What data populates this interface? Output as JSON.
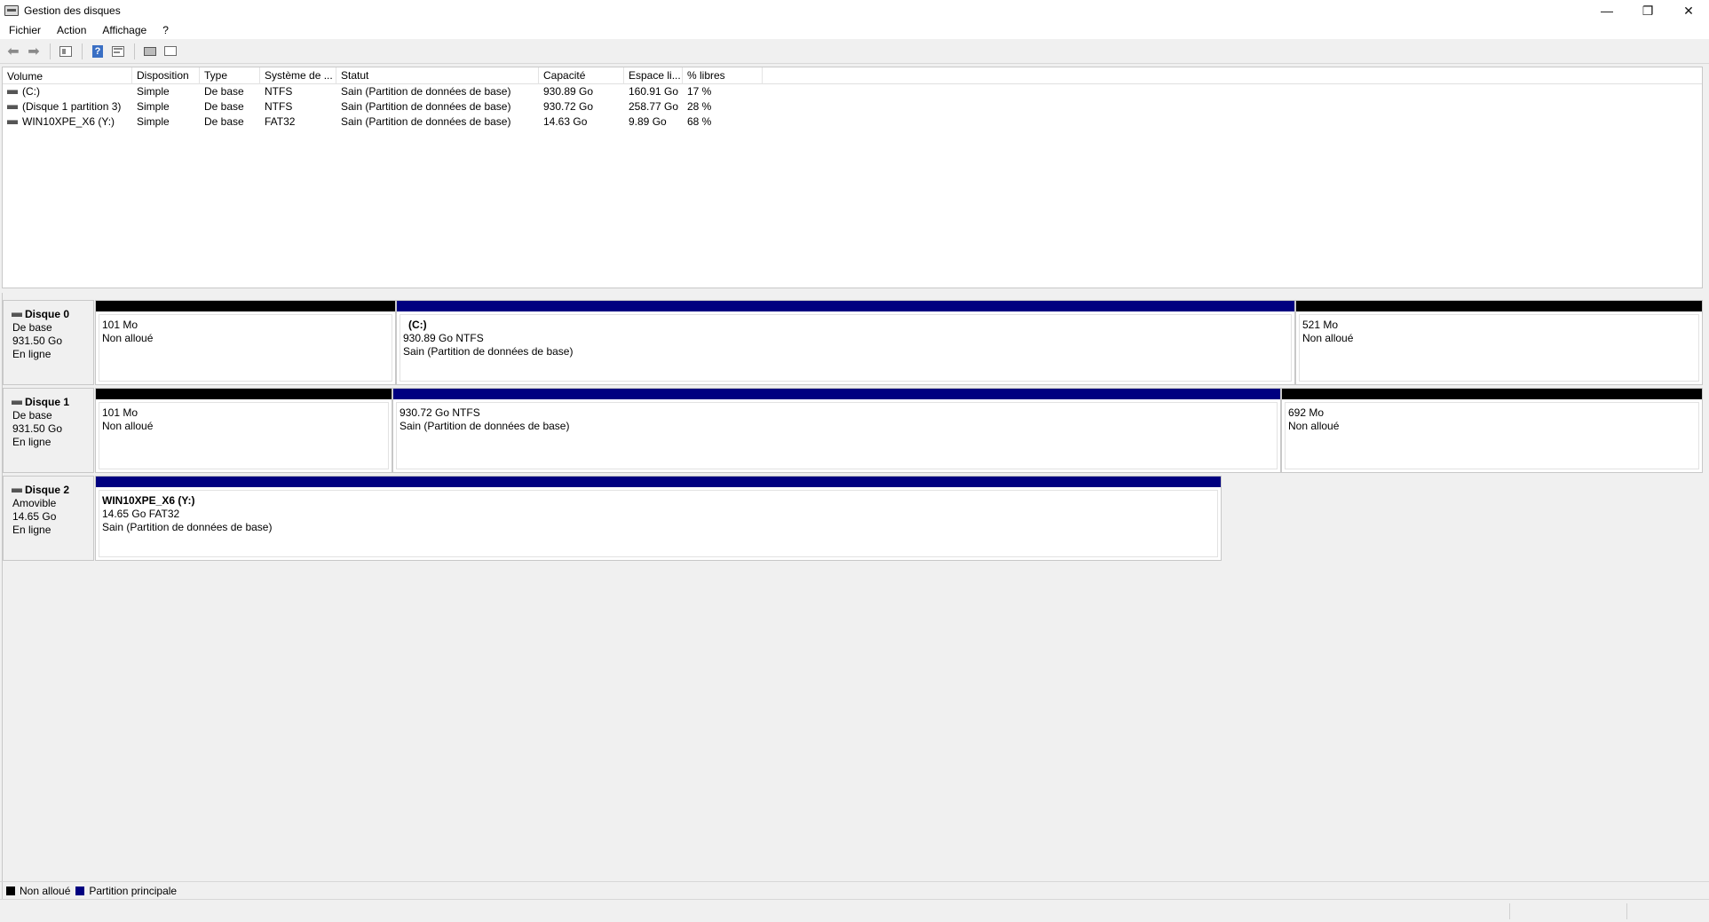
{
  "window": {
    "title": "Gestion des disques",
    "minimize_glyph": "—",
    "maximize_glyph": "❐",
    "close_glyph": "✕"
  },
  "menu": {
    "items": [
      "Fichier",
      "Action",
      "Affichage",
      "?"
    ]
  },
  "toolbar": {
    "icons": [
      "back-arrow-icon",
      "forward-arrow-icon",
      "console-tree-icon",
      "help-icon",
      "properties-icon",
      "disk-connect-icon",
      "panel-icon"
    ]
  },
  "volume_list": {
    "headers": [
      "Volume",
      "Disposition",
      "Type",
      "Système de ...",
      "Statut",
      "Capacité",
      "Espace li...",
      "% libres"
    ],
    "rows": [
      {
        "volume": "(C:)",
        "disposition": "Simple",
        "type": "De base",
        "fs": "NTFS",
        "status": "Sain (Partition de données de base)",
        "capacity": "930.89 Go",
        "free": "160.91 Go",
        "pct": "17 %"
      },
      {
        "volume": "(Disque 1 partition 3)",
        "disposition": "Simple",
        "type": "De base",
        "fs": "NTFS",
        "status": "Sain (Partition de données de base)",
        "capacity": "930.72 Go",
        "free": "258.77 Go",
        "pct": "28 %"
      },
      {
        "volume": "WIN10XPE_X6 (Y:)",
        "disposition": "Simple",
        "type": "De base",
        "fs": "FAT32",
        "status": "Sain (Partition de données de base)",
        "capacity": "14.63 Go",
        "free": "9.89 Go",
        "pct": "68 %"
      }
    ]
  },
  "disks": [
    {
      "name": "Disque 0",
      "kind": "De base",
      "size": "931.50 Go",
      "state": "En ligne",
      "partitions": [
        {
          "title": "",
          "line1": "101 Mo",
          "line2": "Non alloué",
          "color": "#000000"
        },
        {
          "title": "(C:)",
          "line1": "930.89 Go NTFS",
          "line2": "Sain (Partition de données de base)",
          "color": "#000080"
        },
        {
          "title": "",
          "line1": "521 Mo",
          "line2": "Non alloué",
          "color": "#000000"
        }
      ]
    },
    {
      "name": "Disque 1",
      "kind": "De base",
      "size": "931.50 Go",
      "state": "En ligne",
      "partitions": [
        {
          "title": "",
          "line1": "101 Mo",
          "line2": "Non alloué",
          "color": "#000000"
        },
        {
          "title": "",
          "line1": "930.72 Go NTFS",
          "line2": "Sain (Partition de données de base)",
          "color": "#000080"
        },
        {
          "title": "",
          "line1": "692 Mo",
          "line2": "Non alloué",
          "color": "#000000"
        }
      ]
    },
    {
      "name": "Disque 2",
      "kind": "Amovible",
      "size": "14.65 Go",
      "state": "En ligne",
      "partitions": [
        {
          "title": "WIN10XPE_X6  (Y:)",
          "line1": "14.65 Go FAT32",
          "line2": "Sain (Partition de données de base)",
          "color": "#000080"
        }
      ]
    }
  ],
  "legend": [
    {
      "label": "Non alloué",
      "color": "#000000"
    },
    {
      "label": "Partition principale",
      "color": "#000080"
    }
  ]
}
